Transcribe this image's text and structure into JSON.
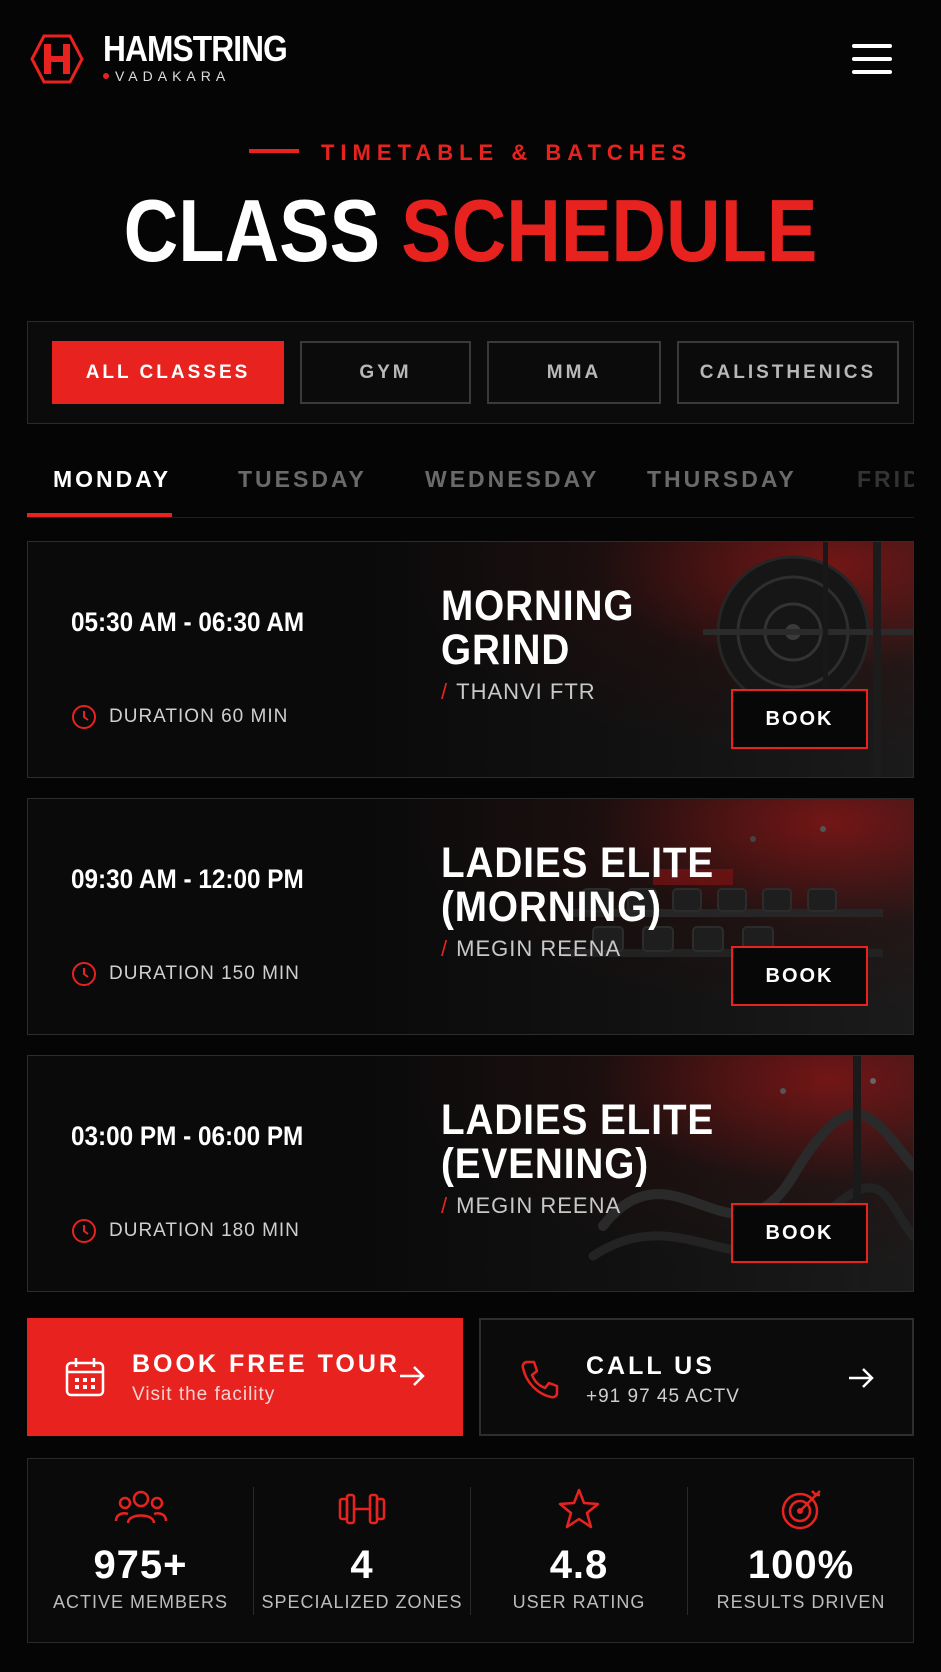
{
  "header": {
    "brand_name": "HAMSTRING",
    "brand_sub": "VADAKARA"
  },
  "hero": {
    "eyebrow": "TIMETABLE & BATCHES",
    "title_white": "CLASS",
    "title_red": "SCHEDULE"
  },
  "filters": [
    {
      "label": "ALL CLASSES",
      "active": true
    },
    {
      "label": "GYM",
      "active": false
    },
    {
      "label": "MMA",
      "active": false
    },
    {
      "label": "CALISTHENICS",
      "active": false
    }
  ],
  "days": [
    {
      "label": "MONDAY",
      "active": true
    },
    {
      "label": "TUESDAY",
      "active": false
    },
    {
      "label": "WEDNESDAY",
      "active": false
    },
    {
      "label": "THURSDAY",
      "active": false
    },
    {
      "label": "FRIDAY",
      "active": false
    }
  ],
  "classes": [
    {
      "time": "05:30 AM - 06:30 AM",
      "duration": "DURATION 60 MIN",
      "name_line1": "MORNING",
      "name_line2": "GRIND",
      "trainer": "THANVI FTR",
      "book_label": "BOOK"
    },
    {
      "time": "09:30 AM - 12:00 PM",
      "duration": "DURATION 150 MIN",
      "name_line1": "LADIES ELITE",
      "name_line2": "(MORNING)",
      "trainer": "MEGIN REENA",
      "book_label": "BOOK"
    },
    {
      "time": "03:00 PM - 06:00 PM",
      "duration": "DURATION 180 MIN",
      "name_line1": "LADIES ELITE",
      "name_line2": "(EVENING)",
      "trainer": "MEGIN REENA",
      "book_label": "BOOK"
    }
  ],
  "cta": {
    "tour_title": "BOOK FREE TOUR",
    "tour_sub": "Visit the facility",
    "call_title": "CALL US",
    "call_sub": "+91 97 45  ACTV"
  },
  "stats": [
    {
      "value": "975+",
      "label": "ACTIVE MEMBERS",
      "icon": "users-icon"
    },
    {
      "value": "4",
      "label": "SPECIALIZED ZONES",
      "icon": "dumbbell-icon"
    },
    {
      "value": "4.8",
      "label": "USER RATING",
      "icon": "star-icon"
    },
    {
      "value": "100%",
      "label": "RESULTS DRIVEN",
      "icon": "target-icon"
    }
  ],
  "colors": {
    "accent": "#e8231f",
    "background": "#050505"
  }
}
